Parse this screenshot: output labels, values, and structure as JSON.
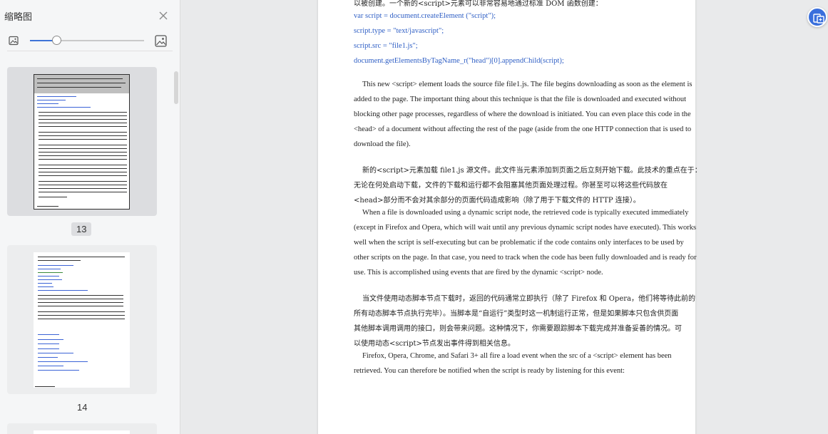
{
  "sidebar": {
    "title": "缩略图",
    "thumbnails": [
      {
        "page_label": "13",
        "selected": true
      },
      {
        "page_label": "14",
        "selected": false
      }
    ],
    "zoom_level": 0.23
  },
  "document": {
    "lines": [
      {
        "text": "以被创建。一个新的<script>元素可以非常容易地通过标准 DOM 函数创建：",
        "kind": "zh"
      },
      {
        "text": "var script = document.createElement (\"script\");",
        "kind": "code"
      },
      {
        "text": "script.type = \"text/javascript\";",
        "kind": "code"
      },
      {
        "text": "script.src = \"file1.js\";",
        "kind": "code"
      },
      {
        "text": "document.getElementsByTagName_r(\"head\")[0].appendChild(script);",
        "kind": "code"
      },
      {
        "text": "This new <script> element loads the source file file1.js. The file begins downloading as soon as the element is",
        "kind": "en",
        "indent": true
      },
      {
        "text": "added to the page. The important thing about this technique is that the file is downloaded and executed without",
        "kind": "en"
      },
      {
        "text": "blocking other page processes, regardless of where the download is initiated. You can even place this code in the",
        "kind": "en"
      },
      {
        "text": "<head> of a document without affecting the rest of the page (aside from the one HTTP connection that is used to",
        "kind": "en"
      },
      {
        "text": "download the file).",
        "kind": "en"
      },
      {
        "text": "新的<script>元素加载 file1.js 源文件。此文件当元素添加到页面之后立刻开始下载。此技术的重点在于：",
        "kind": "zh",
        "indent": true
      },
      {
        "text": "无论在何处启动下载，文件的下载和运行都不会阻塞其他页面处理过程。你甚至可以将这些代码放在",
        "kind": "zh"
      },
      {
        "text": "<head>部分而不会对其余部分的页面代码造成影响（除了用于下载文件的 HTTP 连接）。",
        "kind": "zh"
      },
      {
        "text": "When a file is downloaded using a dynamic script node, the retrieved code is typically executed immediately",
        "kind": "en",
        "indent": true
      },
      {
        "text": "(except in Firefox and Opera, which will wait until any previous dynamic script nodes have executed). This works",
        "kind": "en"
      },
      {
        "text": "well when the script is self-executing but can be problematic if the code contains only interfaces to be used by",
        "kind": "en"
      },
      {
        "text": "other scripts on the page. In that case, you need to track when the code has been fully downloaded and is ready for",
        "kind": "en"
      },
      {
        "text": "use. This is accomplished using events that are fired by the dynamic <script> node.",
        "kind": "en"
      },
      {
        "text": "当文件使用动态脚本节点下载时，返回的代码通常立即执行（除了 Firefox 和 Opera，他们将等待此前的",
        "kind": "zh",
        "indent": true
      },
      {
        "text": "所有动态脚本节点执行完毕）。当脚本是“自运行”类型时这一机制运行正常，但是如果脚本只包含供页面",
        "kind": "zh"
      },
      {
        "text": "其他脚本调用调用的接口，则会带来问题。这种情况下，你需要跟踪脚本下载完成并准备妥善的情况。可",
        "kind": "zh"
      },
      {
        "text": "以使用动态<script>节点发出事件得到相关信息。",
        "kind": "zh"
      },
      {
        "text": "Firefox, Opera, Chrome, and Safari 3+ all fire a load event when the src of a <script> element has been",
        "kind": "en",
        "indent": true
      },
      {
        "text": "retrieved. You can therefore be notified when the script is ready by listening for this event:",
        "kind": "en"
      }
    ]
  },
  "icons": {
    "close": "close-icon",
    "image_small": "image-small-icon",
    "image_large": "image-large-icon",
    "float_action": "floating-tool-icon"
  },
  "colors": {
    "accent": "#3a6fdc",
    "code_text": "#2f5fc5",
    "thumb_selected_bg": "#dcdde0"
  }
}
